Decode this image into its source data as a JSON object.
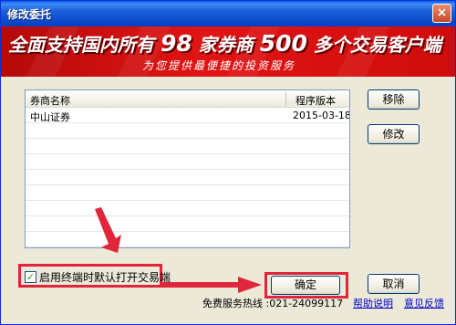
{
  "window": {
    "title": "修改委托",
    "close_label": "×"
  },
  "banner": {
    "headline_pre": "全面支持国内所有",
    "num1": "98",
    "headline_mid": "家券商",
    "num2": "500",
    "headline_post": "多个交易客户端",
    "subtitle": "为您提供最便捷的投资服务"
  },
  "broker_list": {
    "columns": [
      "券商名称",
      "程序版本"
    ],
    "rows": [
      {
        "name": "中山证券",
        "version": "2015-03-18"
      }
    ]
  },
  "buttons": {
    "remove": "移除",
    "modify": "修改",
    "confirm": "确定",
    "cancel": "取消"
  },
  "startup_option": {
    "label": "启用终端时默认打开交易端",
    "checked": true
  },
  "footer": {
    "hotline": "免费服务热线 :021-24099117",
    "help": "帮助说明",
    "feedback": "意见反馈"
  },
  "colors": {
    "highlight": "#e0263a",
    "banner": "#d00f0f"
  }
}
